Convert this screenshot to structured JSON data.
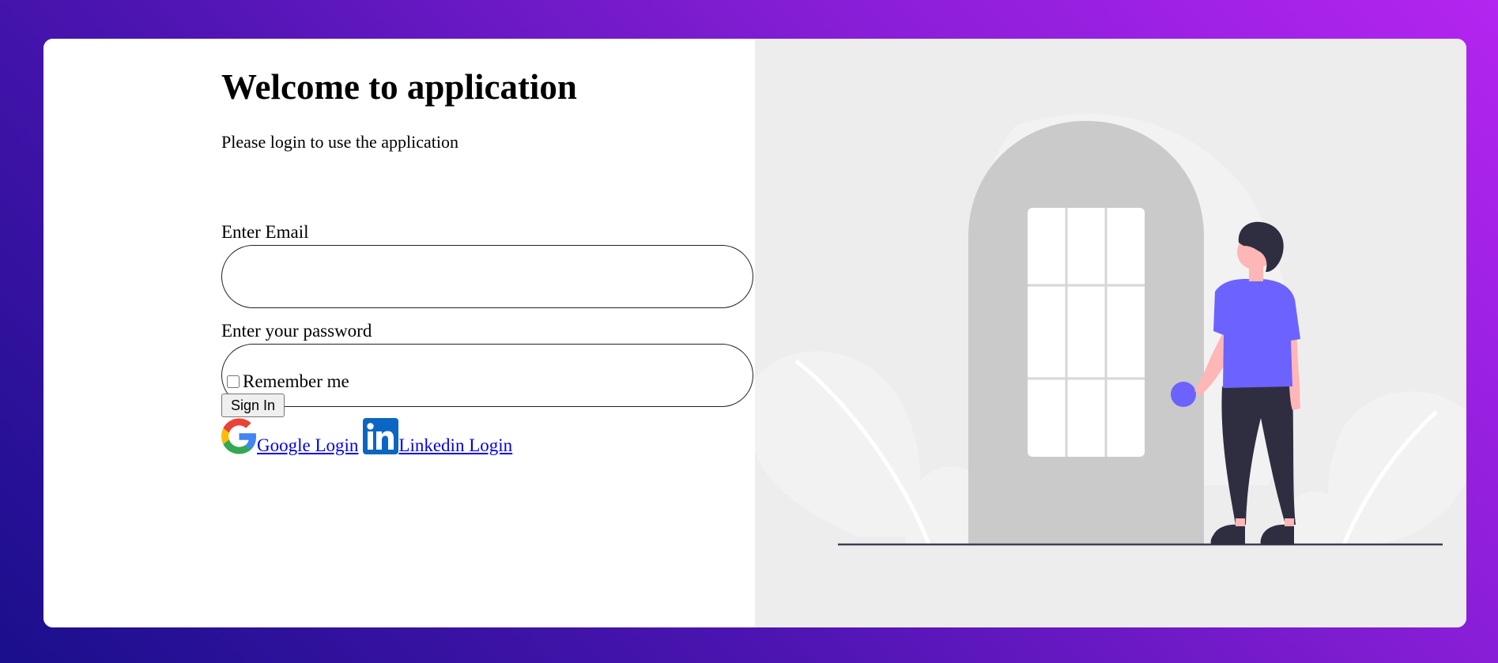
{
  "heading": "Welcome to application",
  "subtitle": "Please login to use the application",
  "email": {
    "label": "Enter Email",
    "value": "",
    "placeholder": ""
  },
  "password": {
    "label": "Enter your password",
    "value": "",
    "placeholder": ""
  },
  "remember_me": {
    "label": "Remember me",
    "checked": false
  },
  "sign_in_label": "Sign In",
  "social": {
    "google_label": "Google Login",
    "linkedin_label": " Linkedin Login"
  },
  "colors": {
    "gradient_start": "#1a0f8c",
    "gradient_end": "#b425f0",
    "illustration_bg": "#ededed",
    "door": "#cacaca",
    "shirt": "#6c63ff",
    "pants": "#2f2e41",
    "skin": "#ffb6b6",
    "linkedin": "#0a66c2",
    "link": "#0000ee"
  },
  "icons": [
    "google-logo-icon",
    "linkedin-logo-icon"
  ]
}
